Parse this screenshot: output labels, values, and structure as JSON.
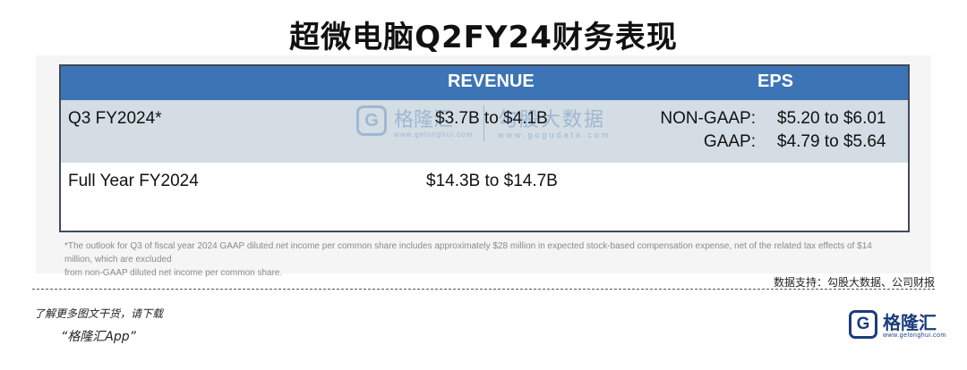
{
  "title": "超微电脑Q2FY24财务表现",
  "table": {
    "headers": {
      "revenue": "REVENUE",
      "eps": "EPS"
    },
    "rows": [
      {
        "period": "Q3 FY2024*",
        "revenue": "$3.7B to $4.1B",
        "eps_lines": [
          {
            "label": "NON-GAAP:",
            "value": "$5.20 to $6.01"
          },
          {
            "label": "GAAP:",
            "value": "$4.79 to $5.64"
          }
        ]
      },
      {
        "period": "Full Year FY2024",
        "revenue": "$14.3B to $14.7B"
      }
    ]
  },
  "watermark": {
    "brand": "格隆汇",
    "brand_url": "www.gelonghui.com",
    "product": "勾股大数据",
    "product_url": "www.gogudata.com"
  },
  "footnote": {
    "line1": "*The outlook for Q3 of fiscal year 2024 GAAP diluted net income per common share includes approximately $28 million in expected stock-based compensation expense, net of the related tax effects of $14 million, which are excluded",
    "line2": "from non-GAAP diluted net income per common share."
  },
  "source": "数据支持：勾股大数据、公司财报",
  "promo": {
    "line1": "了解更多图文干货，请下载",
    "line2": "“格隆汇App”"
  },
  "brand": {
    "name": "格隆汇",
    "url": "www.gelonghui.com",
    "logo_letter": "G"
  },
  "colors": {
    "header_bg": "#3d74b5",
    "row_highlight": "#d3dde3",
    "brand": "#1a3d7a"
  }
}
